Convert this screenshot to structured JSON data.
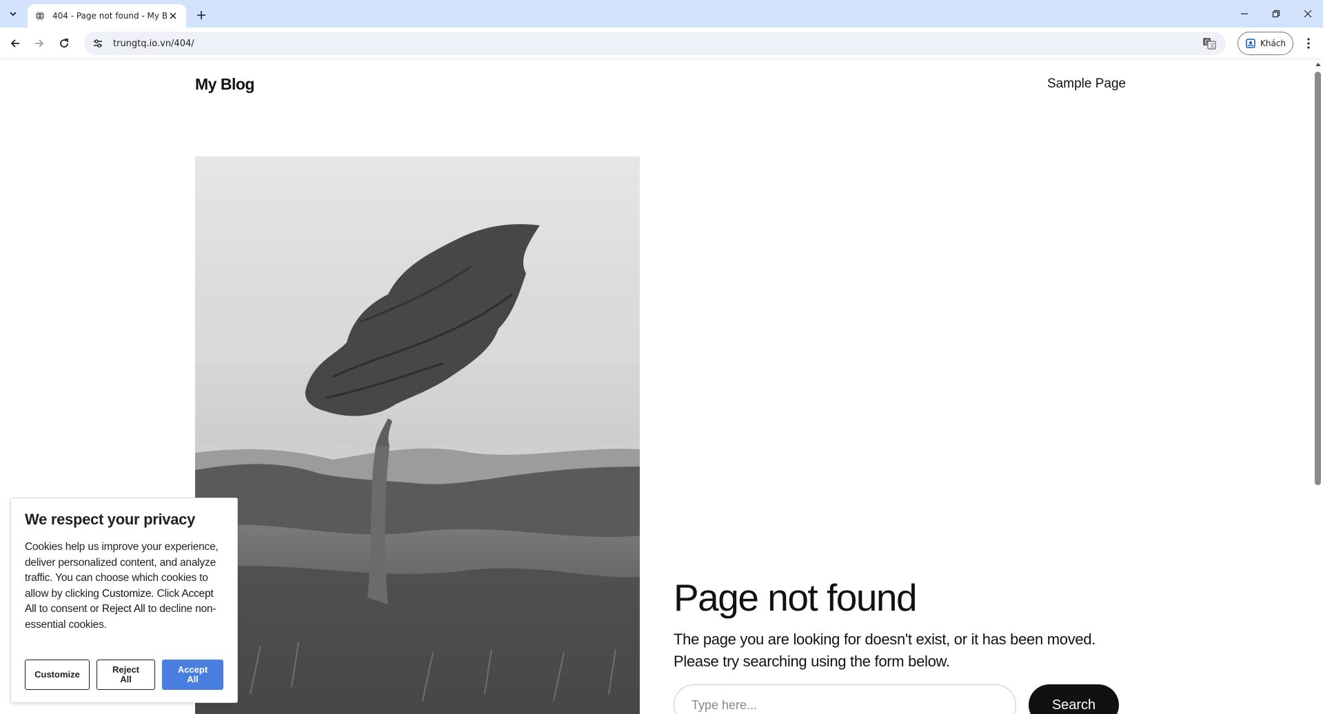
{
  "browser": {
    "tab_title": "404 - Page not found - My Blog",
    "url": "trungtq.io.vn/404/",
    "profile_label": "Khách"
  },
  "page": {
    "site_title": "My Blog",
    "nav_link": "Sample Page",
    "heading": "Page not found",
    "message": "The page you are looking for doesn't exist, or it has been moved. Please try searching using the form below.",
    "search_placeholder": "Type here...",
    "search_button": "Search"
  },
  "cookie_banner": {
    "title": "We respect your privacy",
    "body_1": "Cookies help us improve your experience, deliver personalized content, and analyze traffic. You can choose which cookies to allow by clicking ",
    "body_customize": "Customize",
    "body_2": ". Click ",
    "body_accept": "Accept All",
    "body_3": " to consent or ",
    "body_reject": "Reject All",
    "body_4": " to decline non-essential cookies.",
    "customize_label": "Customize",
    "reject_label": "Reject All",
    "accept_label": "Accept All",
    "accent_color": "#4a7fe0"
  },
  "icons": {
    "tab_list": "chevron-down-icon",
    "favicon": "globe-icon",
    "close_tab": "close-icon",
    "new_tab": "plus-icon",
    "back": "arrow-left-icon",
    "forward": "arrow-right-icon",
    "reload": "reload-icon",
    "site_info": "tune-icon",
    "translate": "translate-icon",
    "profile": "person-icon",
    "menu": "more-vertical-icon"
  }
}
